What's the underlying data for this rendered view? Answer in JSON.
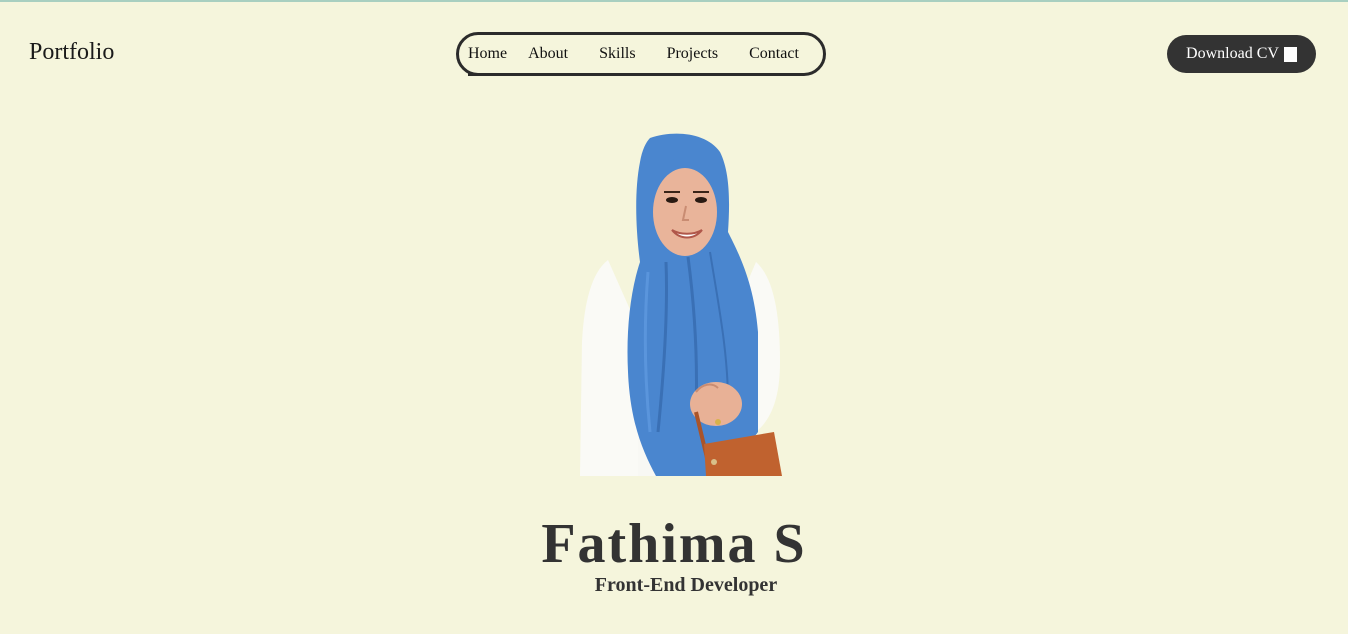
{
  "header": {
    "logo": "Portfolio",
    "nav": [
      "Home",
      "About",
      "Skills",
      "Projects",
      "Contact"
    ],
    "active_nav": "Home",
    "cv_button": "Download CV"
  },
  "hero": {
    "name": "Fathima S",
    "role": "Front-End Developer"
  },
  "colors": {
    "background": "#f5f5dc",
    "button": "#333333",
    "hijab": "#4a86cf",
    "bag": "#c0622f"
  }
}
